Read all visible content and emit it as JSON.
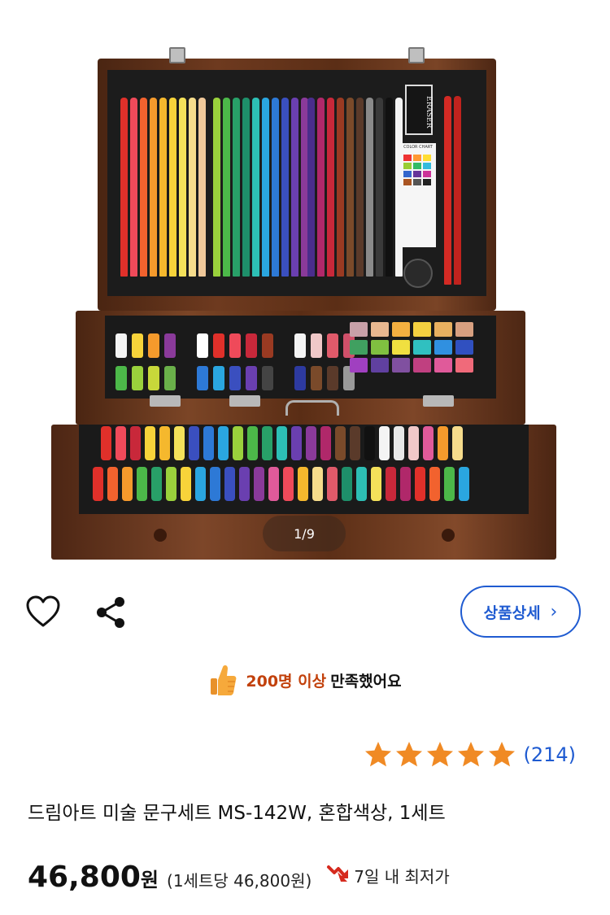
{
  "image": {
    "badge": "1/9",
    "eraser_text": "ERASER",
    "chart_title": "COLOR CHART"
  },
  "actions": {
    "detail_label": "상품상세"
  },
  "satisfaction": {
    "highlight": "200명 이상",
    "rest": "만족했어요"
  },
  "rating": {
    "stars": 5,
    "review_count": "(214)"
  },
  "product": {
    "title": "드림아트 미술 문구세트 MS-142W, 혼합색상, 1세트",
    "price": "46,800",
    "price_unit": "원",
    "unit_price": "(1세트당 46,800원)",
    "lowest_label": "7일 내 최저가"
  },
  "colors": {
    "accent_blue": "#1f5bd1",
    "highlight_orange": "#c2410c",
    "star_orange": "#f08a24",
    "lowest_icon_red": "#d62a1e"
  },
  "icons": [
    "heart-icon",
    "share-icon",
    "chevron-right-icon",
    "thumbs-up-icon",
    "star-icon",
    "price-down-icon"
  ]
}
